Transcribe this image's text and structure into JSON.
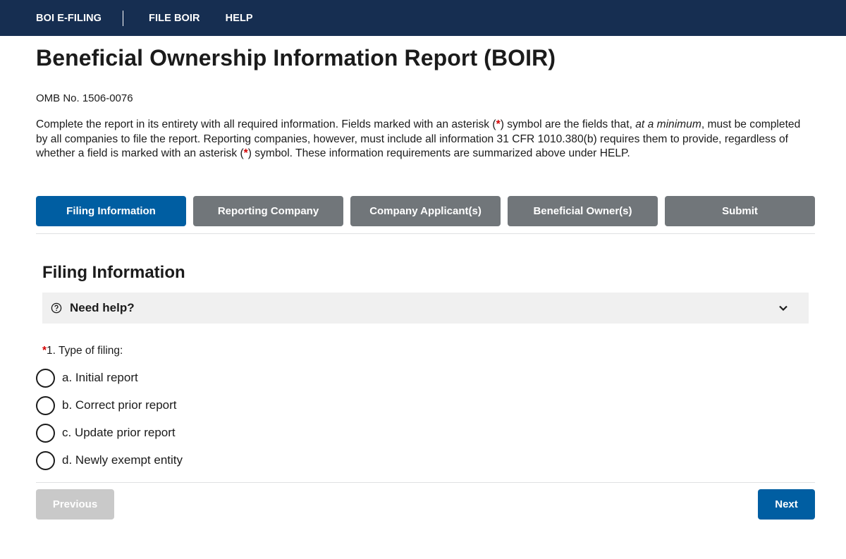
{
  "nav": {
    "brand": "BOI E-FILING",
    "items": [
      {
        "label": "FILE BOIR"
      },
      {
        "label": "HELP"
      }
    ]
  },
  "page": {
    "title": "Beneficial Ownership Information Report (BOIR)",
    "omb": "OMB No. 1506-0076",
    "intro": {
      "part1": "Complete the report in its entirety with all required information. Fields marked with an asterisk (",
      "asterisk": "*",
      "part2": ") symbol are the fields that, ",
      "emphasis": "at a minimum",
      "part3": ", must be completed by all companies to file the report. Reporting companies, however, must include all information 31 CFR 1010.380(b) requires them to provide, regardless of whether a field is marked with an asterisk (",
      "part4": ") symbol. These information requirements are summarized above under HELP."
    }
  },
  "steps": [
    {
      "label": "Filing Information",
      "active": true
    },
    {
      "label": "Reporting Company",
      "active": false
    },
    {
      "label": "Company Applicant(s)",
      "active": false
    },
    {
      "label": "Beneficial Owner(s)",
      "active": false
    },
    {
      "label": "Submit",
      "active": false
    }
  ],
  "section": {
    "title": "Filing Information",
    "help": {
      "icon": "help-circle-icon",
      "label": "Need help?",
      "chevron": "chevron-down-icon",
      "expanded": false
    },
    "question": {
      "required_marker": "*",
      "label": "1. Type of filing:",
      "options": [
        {
          "label": "a. Initial report",
          "selected": false
        },
        {
          "label": "b. Correct prior report",
          "selected": false
        },
        {
          "label": "c. Update prior report",
          "selected": false
        },
        {
          "label": "d. Newly exempt entity",
          "selected": false
        }
      ]
    }
  },
  "footer": {
    "previous_label": "Previous",
    "previous_disabled": true,
    "next_label": "Next"
  },
  "colors": {
    "nav_bg": "#162e51",
    "primary": "#005ea2",
    "step_inactive": "#71767a",
    "disabled": "#c9c9c9",
    "required": "#d30000",
    "accordion_bg": "#f0f0f0"
  }
}
